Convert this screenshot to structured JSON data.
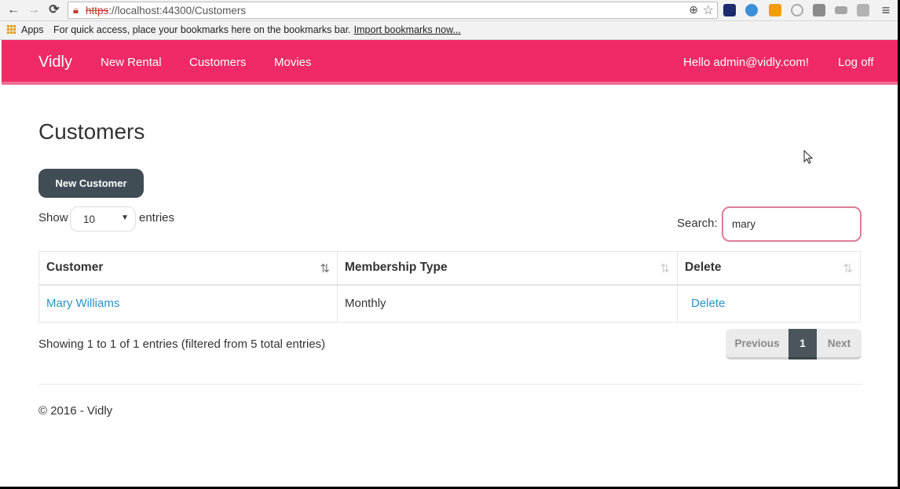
{
  "browser": {
    "url_scheme": "https",
    "url_rest": "://localhost:44300/Customers",
    "bookmarks_apps": "Apps",
    "bookmarks_hint": "For quick access, place your bookmarks here on the bookmarks bar.",
    "bookmarks_import": "Import bookmarks now..."
  },
  "navbar": {
    "brand": "Vidly",
    "links": [
      "New Rental",
      "Customers",
      "Movies"
    ],
    "greeting": "Hello admin@vidly.com!",
    "logoff": "Log off",
    "color": "#ef2a66"
  },
  "page": {
    "title": "Customers",
    "new_customer_label": "New Customer"
  },
  "table_controls": {
    "show_label": "Show",
    "page_length": "10",
    "entries_label": "entries",
    "search_label": "Search:",
    "search_value": "mary"
  },
  "table": {
    "headers": [
      "Customer",
      "Membership Type",
      "Delete"
    ],
    "rows": [
      {
        "customer": "Mary Williams",
        "membership": "Monthly",
        "delete": "Delete"
      }
    ]
  },
  "pagination": {
    "info": "Showing 1 to 1 of 1 entries (filtered from 5 total entries)",
    "previous": "Previous",
    "current": "1",
    "next": "Next"
  },
  "footer": {
    "text": "© 2016 - Vidly"
  }
}
